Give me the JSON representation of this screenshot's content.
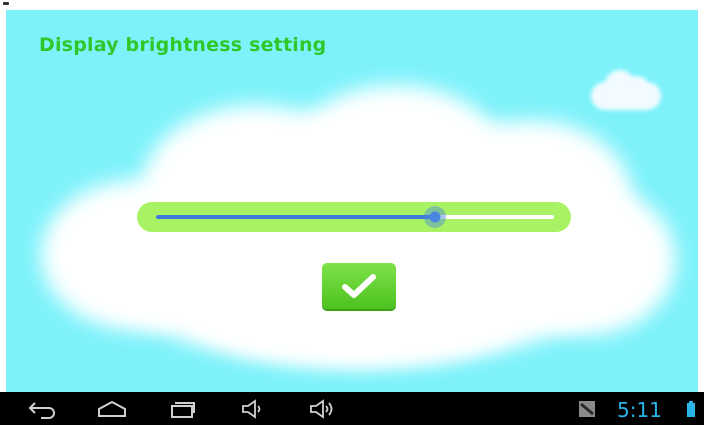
{
  "title": "Display brightness setting",
  "brightness": {
    "level_percent": 70
  },
  "confirm": {
    "icon": "checkmark-icon"
  },
  "colors": {
    "sky": "#7df2fb",
    "title": "#2fc72a",
    "slider_bg": "#a8f263",
    "slider_fill": "#3d79d6",
    "button": "#4cc21f",
    "navbar": "#000000",
    "clock": "#2ab4e8"
  },
  "navbar": {
    "buttons": [
      {
        "icon": "back-icon"
      },
      {
        "icon": "home-icon"
      },
      {
        "icon": "recent-apps-icon"
      },
      {
        "icon": "volume-down-icon"
      },
      {
        "icon": "volume-up-icon"
      }
    ],
    "notification_icon": "screenshot-notification-icon",
    "time": "5:11",
    "battery_icon": "battery-icon"
  }
}
